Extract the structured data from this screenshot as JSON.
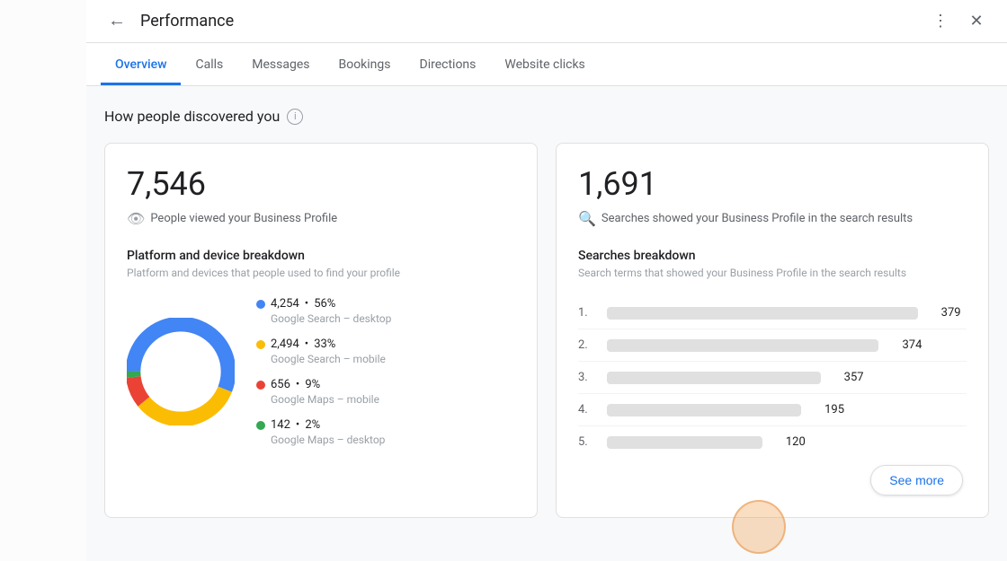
{
  "header": {
    "title": "Performance",
    "back_label": "←",
    "more_icon": "⋮",
    "close_icon": "✕"
  },
  "tabs": [
    {
      "id": "overview",
      "label": "Overview",
      "active": true
    },
    {
      "id": "calls",
      "label": "Calls",
      "active": false
    },
    {
      "id": "messages",
      "label": "Messages",
      "active": false
    },
    {
      "id": "bookings",
      "label": "Bookings",
      "active": false
    },
    {
      "id": "directions",
      "label": "Directions",
      "active": false
    },
    {
      "id": "website-clicks",
      "label": "Website clicks",
      "active": false
    }
  ],
  "section": {
    "title": "How people discovered you"
  },
  "views_card": {
    "number": "7,546",
    "description": "People viewed your Business Profile",
    "breakdown_title": "Platform and device breakdown",
    "breakdown_subtitle": "Platform and devices that people used to find your profile",
    "legend": [
      {
        "id": "google-search-desktop",
        "value": "4,254",
        "percent": "56%",
        "label": "Google Search – desktop",
        "color": "#4285f4"
      },
      {
        "id": "google-search-mobile",
        "value": "2,494",
        "percent": "33%",
        "label": "Google Search – mobile",
        "color": "#fbbc04"
      },
      {
        "id": "google-maps-mobile",
        "value": "656",
        "percent": "9%",
        "label": "Google Maps – mobile",
        "color": "#ea4335"
      },
      {
        "id": "google-maps-desktop",
        "value": "142",
        "percent": "2%",
        "label": "Google Maps – desktop",
        "color": "#34a853"
      }
    ],
    "chart": {
      "segments": [
        {
          "percent": 56,
          "color": "#4285f4"
        },
        {
          "percent": 33,
          "color": "#fbbc04"
        },
        {
          "percent": 9,
          "color": "#ea4335"
        },
        {
          "percent": 2,
          "color": "#34a853"
        }
      ]
    }
  },
  "searches_card": {
    "number": "1,691",
    "description": "Searches showed your Business Profile in the search results",
    "breakdown_title": "Searches breakdown",
    "breakdown_subtitle": "Search terms that showed your Business Profile in the search results",
    "items": [
      {
        "rank": "1.",
        "count": "379",
        "bar_width": "80"
      },
      {
        "rank": "2.",
        "count": "374",
        "bar_width": "70"
      },
      {
        "rank": "3.",
        "count": "357",
        "bar_width": "55"
      },
      {
        "rank": "4.",
        "count": "195",
        "bar_width": "50"
      },
      {
        "rank": "5.",
        "count": "120",
        "bar_width": "40"
      }
    ]
  },
  "see_more_button": {
    "label": "See more"
  }
}
